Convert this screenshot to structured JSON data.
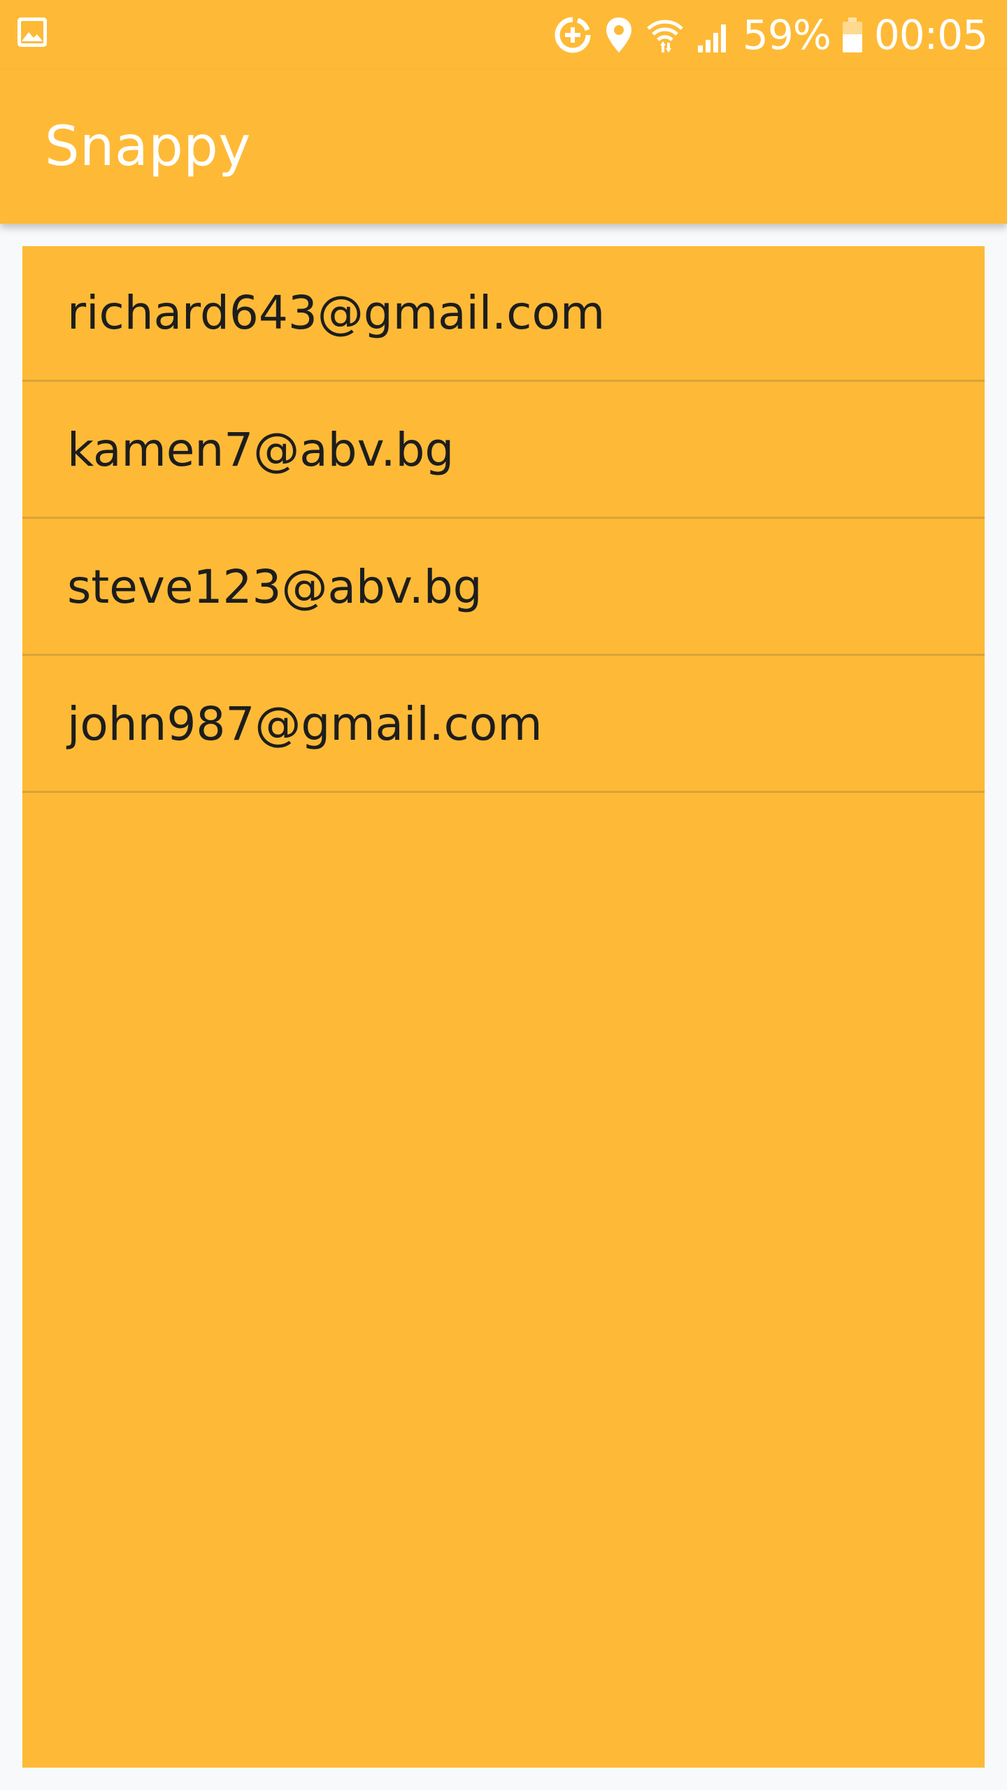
{
  "status_bar": {
    "battery_percent": "59%",
    "time": "00:05",
    "icons": [
      "gallery-icon",
      "data-saver-icon",
      "location-icon",
      "wifi-icon",
      "signal-icon",
      "battery-icon"
    ]
  },
  "app_bar": {
    "title": "Snappy"
  },
  "emails": [
    {
      "address": "richard643@gmail.com"
    },
    {
      "address": "kamen7@abv.bg"
    },
    {
      "address": "steve123@abv.bg"
    },
    {
      "address": "john987@gmail.com"
    }
  ],
  "colors": {
    "primary": "#feba36",
    "divider": "#d9a33c",
    "text": "#1d1d1d",
    "on_primary": "#ffffff",
    "background": "#f8f9fa"
  }
}
